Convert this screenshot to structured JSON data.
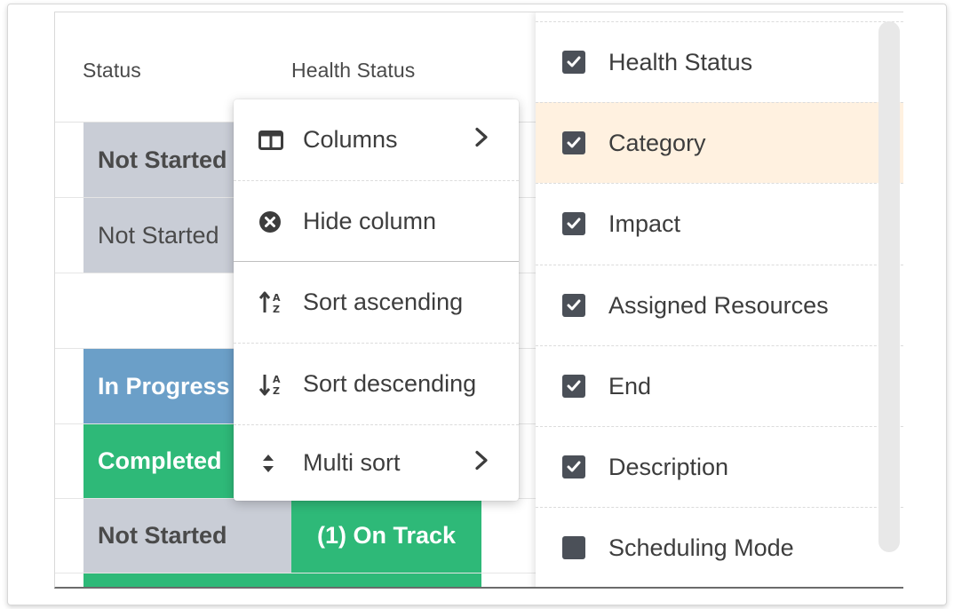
{
  "grid": {
    "headers": {
      "status": "Status",
      "health": "Health Status"
    },
    "rows": [
      {
        "status": "Not Started",
        "status_bg": "#c9cdd6",
        "status_color": "#4a4a4a",
        "bold": true,
        "health": "",
        "health_bg": "#ffffff",
        "health_color": "#ffffff"
      },
      {
        "status": "Not Started",
        "status_bg": "#c9cdd6",
        "status_color": "#4a4a4a",
        "bold": false,
        "health": "",
        "health_bg": "#2eb978",
        "health_color": "#ffffff"
      },
      {
        "status": "",
        "status_bg": "#ffffff",
        "status_color": "#4a4a4a",
        "bold": false,
        "health": "",
        "health_bg": "#ffffff",
        "health_color": "#ffffff"
      },
      {
        "status": "In Progress",
        "status_bg": "#6b9fc8",
        "status_color": "#ffffff",
        "bold": true,
        "health": "",
        "health_bg": "#ffffff",
        "health_color": "#ffffff"
      },
      {
        "status": "Completed",
        "status_bg": "#2eb978",
        "status_color": "#ffffff",
        "bold": true,
        "health": "",
        "health_bg": "#2eb978",
        "health_color": "#ffffff"
      },
      {
        "status": "Not Started",
        "status_bg": "#c9cdd6",
        "status_color": "#4a4a4a",
        "bold": true,
        "health": "(1) On Track",
        "health_bg": "#2eb978",
        "health_color": "#ffffff"
      },
      {
        "status": "",
        "status_bg": "#2eb978",
        "status_color": "#ffffff",
        "bold": true,
        "health": "",
        "health_bg": "#2eb978",
        "health_color": "#ffffff"
      }
    ]
  },
  "context_menu": {
    "items": [
      {
        "label": "Columns",
        "icon": "columns-icon",
        "submenu": true,
        "active": true
      },
      {
        "label": "Hide column",
        "icon": "hide-column-icon",
        "submenu": false,
        "active": false
      },
      {
        "label": "Sort ascending",
        "icon": "sort-ascending-icon",
        "submenu": false,
        "active": false
      },
      {
        "label": "Sort descending",
        "icon": "sort-descending-icon",
        "submenu": false,
        "active": false
      },
      {
        "label": "Multi sort",
        "icon": "multi-sort-icon",
        "submenu": true,
        "active": false
      }
    ]
  },
  "columns_submenu": {
    "items": [
      {
        "label": "Health Status",
        "checked": true,
        "highlighted": false
      },
      {
        "label": "Category",
        "checked": true,
        "highlighted": true
      },
      {
        "label": "Impact",
        "checked": true,
        "highlighted": false
      },
      {
        "label": "Assigned Resources",
        "checked": true,
        "highlighted": false
      },
      {
        "label": "End",
        "checked": true,
        "highlighted": false
      },
      {
        "label": "Description",
        "checked": true,
        "highlighted": false
      },
      {
        "label": "Scheduling Mode",
        "checked": false,
        "highlighted": false
      }
    ]
  },
  "colors": {
    "menu_active": "#ffe8cc",
    "submenu_highlight": "#fff1e0",
    "checkbox": "#4b5058",
    "green": "#2eb978",
    "blue": "#6b9fc8",
    "grey": "#c9cdd6"
  }
}
